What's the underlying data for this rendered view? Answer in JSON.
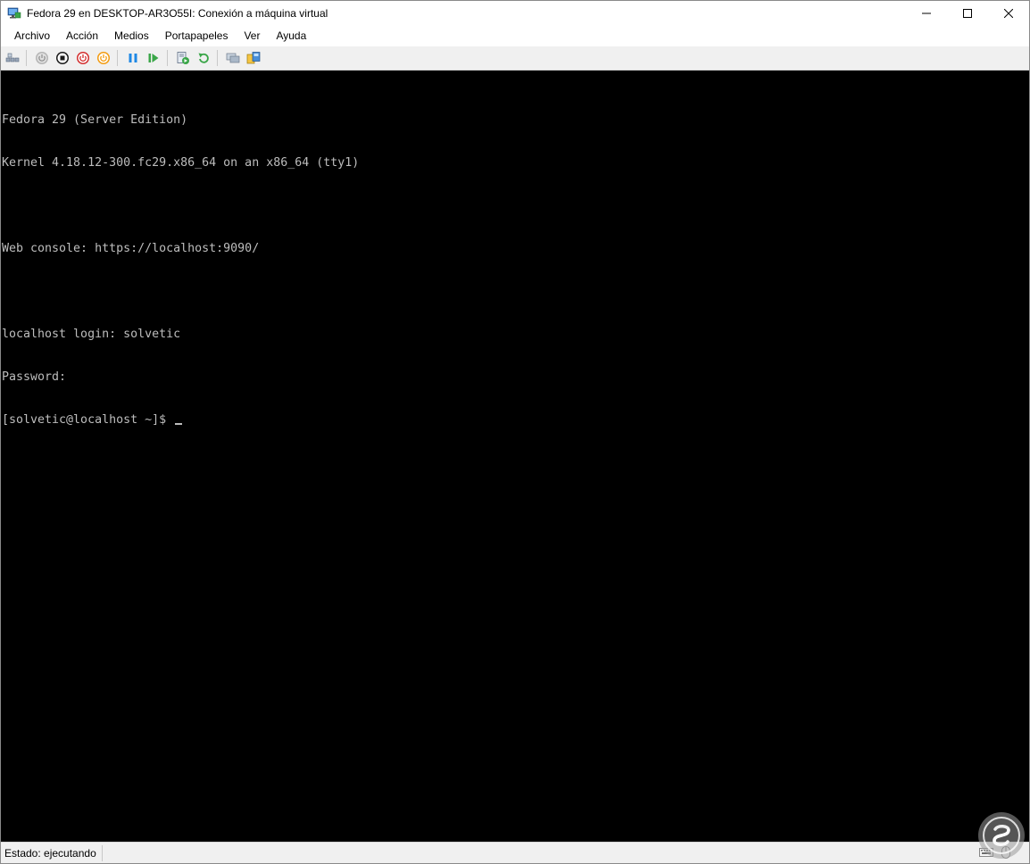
{
  "window": {
    "title": "Fedora 29 en DESKTOP-AR3O55I: Conexión a máquina virtual"
  },
  "menu": {
    "items": [
      "Archivo",
      "Acción",
      "Medios",
      "Portapapeles",
      "Ver",
      "Ayuda"
    ]
  },
  "toolbar": {
    "buttons": [
      "ctrl-alt-del-icon",
      "start-icon",
      "turn-off-icon",
      "shut-down-icon",
      "save-icon",
      "pause-icon",
      "resume-icon",
      "checkpoint-icon",
      "revert-icon",
      "enhanced-session-icon",
      "share-icon"
    ]
  },
  "console": {
    "lines": [
      "Fedora 29 (Server Edition)",
      "Kernel 4.18.12-300.fc29.x86_64 on an x86_64 (tty1)",
      "",
      "Web console: https://localhost:9090/",
      "",
      "localhost login: solvetic",
      "Password:",
      "[solvetic@localhost ~]$ "
    ],
    "fg_color": "#bdbdbd",
    "bg_color": "#000000"
  },
  "status": {
    "text": "Estado: ejecutando"
  },
  "colors": {
    "red": "#d32f2f",
    "orange": "#f39c12",
    "blue": "#1e88e5",
    "green": "#3aa648",
    "gray": "#8c8c8c"
  }
}
